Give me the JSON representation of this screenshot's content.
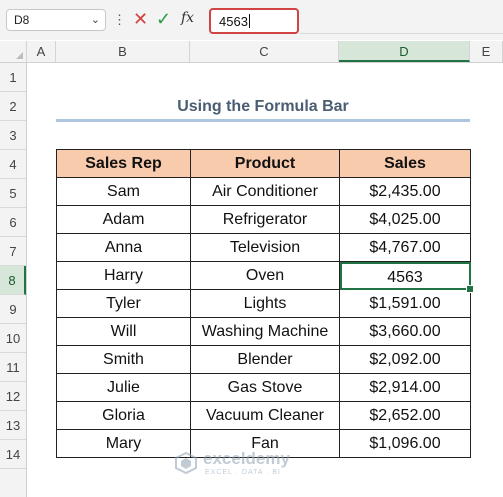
{
  "formula_bar": {
    "name_box": "D8",
    "name_box_chevron": "chevron-down-icon",
    "more_icon": "more-vertical-icon",
    "cancel_icon": "close-icon",
    "enter_icon": "check-icon",
    "fx_label": "fx",
    "content": "4563"
  },
  "columns": [
    "A",
    "B",
    "C",
    "D",
    "E"
  ],
  "active_column": "D",
  "rows": [
    "1",
    "2",
    "3",
    "4",
    "5",
    "6",
    "7",
    "8",
    "9",
    "10",
    "11",
    "12",
    "13",
    "14"
  ],
  "active_row": "8",
  "title": "Using the Formula Bar",
  "table": {
    "headers": [
      "Sales Rep",
      "Product",
      "Sales"
    ],
    "rows": [
      [
        "Sam",
        "Air Conditioner",
        "$2,435.00"
      ],
      [
        "Adam",
        "Refrigerator",
        "$4,025.00"
      ],
      [
        "Anna",
        "Television",
        "$4,767.00"
      ],
      [
        "Harry",
        "Oven",
        "4563"
      ],
      [
        "Tyler",
        "Lights",
        "$1,591.00"
      ],
      [
        "Will",
        "Washing Machine",
        "$3,660.00"
      ],
      [
        "Smith",
        "Blender",
        "$2,092.00"
      ],
      [
        "Julie",
        "Gas Stove",
        "$2,914.00"
      ],
      [
        "Gloria",
        "Vacuum Cleaner",
        "$2,652.00"
      ],
      [
        "Mary",
        "Fan",
        "$1,096.00"
      ]
    ]
  },
  "watermark": {
    "name": "exceldemy",
    "tagline": "EXCEL · DATA · BI"
  },
  "colors": {
    "header_fill": "#f8cbad",
    "accent_green": "#217346",
    "formula_border": "#d04444",
    "title_color": "#4a5d72",
    "title_underline": "#aec6dd"
  }
}
